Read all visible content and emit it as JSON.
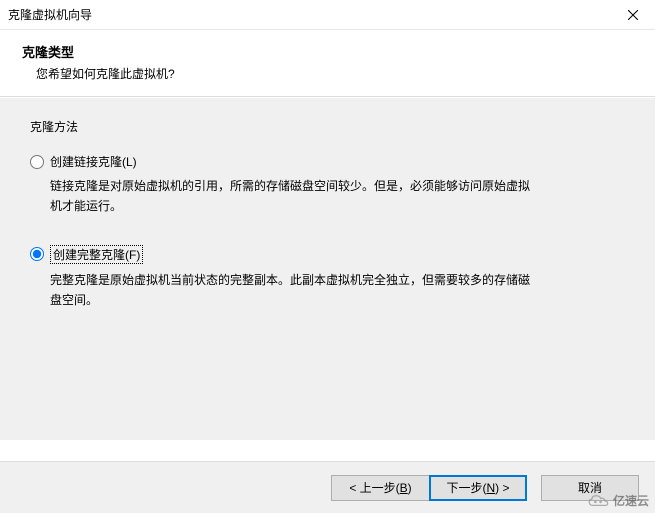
{
  "titlebar": {
    "title": "克隆虚拟机向导"
  },
  "header": {
    "title": "克隆类型",
    "subtitle": "您希望如何克隆此虚拟机?"
  },
  "content": {
    "section_label": "克隆方法",
    "options": [
      {
        "label": "创建链接克隆(L)",
        "hotkey": "L",
        "desc": "链接克隆是对原始虚拟机的引用，所需的存储磁盘空间较少。但是，必须能够访问原始虚拟机才能运行。",
        "checked": false
      },
      {
        "label": "创建完整克隆(F)",
        "hotkey": "F",
        "desc": "完整克隆是原始虚拟机当前状态的完整副本。此副本虚拟机完全独立，但需要较多的存储磁盘空间。",
        "checked": true
      }
    ]
  },
  "buttons": {
    "back": "< 上一步(B)",
    "next": "下一步(N) >",
    "cancel": "取消"
  },
  "watermark": {
    "text": "亿速云"
  }
}
